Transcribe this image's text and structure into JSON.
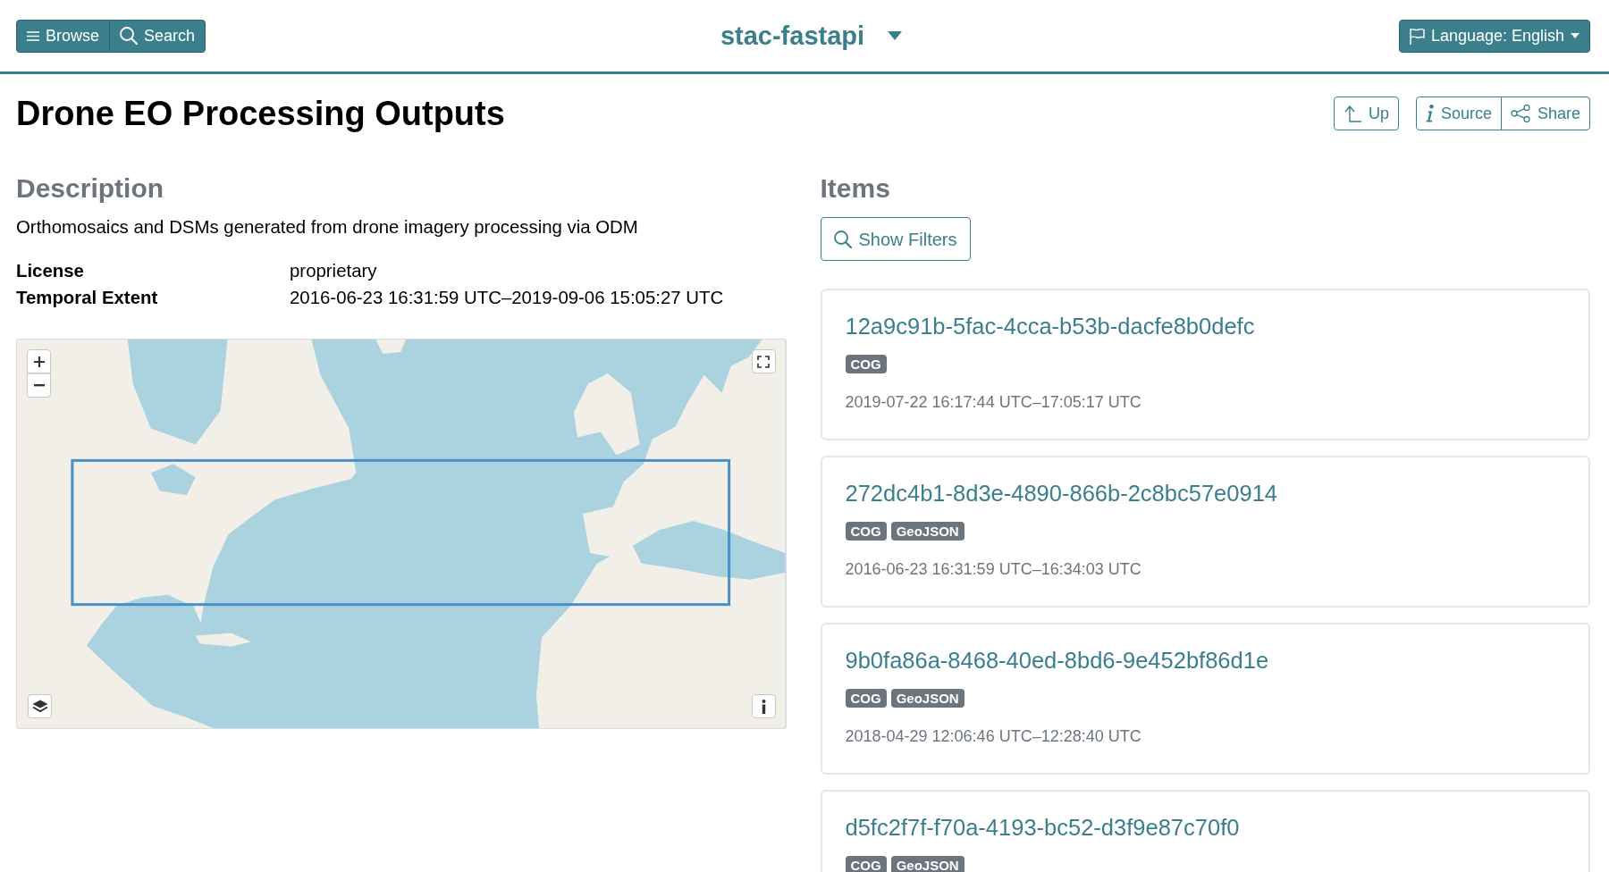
{
  "navbar": {
    "browse_button": "Browse",
    "search_button": "Search",
    "title": "stac-fastapi",
    "language_button": "Language: English"
  },
  "header": {
    "title": "Drone EO Processing Outputs",
    "up_button": "Up",
    "source_button": "Source",
    "share_button": "Share"
  },
  "description": {
    "heading": "Description",
    "text": "Orthomosaics and DSMs generated from drone imagery processing via ODM",
    "metadata": [
      {
        "label": "License",
        "value": "proprietary"
      },
      {
        "label": "Temporal Extent",
        "value": "2016-06-23 16:31:59 UTC–2019-09-06 15:05:27 UTC"
      }
    ]
  },
  "items": {
    "heading": "Items",
    "filter_button": "Show Filters",
    "list": [
      {
        "id": "12a9c91b-5fac-4cca-b53b-dacfe8b0defc",
        "tags": [
          "COG"
        ],
        "datetime": "2019-07-22 16:17:44 UTC–17:05:17 UTC"
      },
      {
        "id": "272dc4b1-8d3e-4890-866b-2c8bc57e0914",
        "tags": [
          "COG",
          "GeoJSON"
        ],
        "datetime": "2016-06-23 16:31:59 UTC–16:34:03 UTC"
      },
      {
        "id": "9b0fa86a-8468-40ed-8bd6-9e452bf86d1e",
        "tags": [
          "COG",
          "GeoJSON"
        ],
        "datetime": "2018-04-29 12:06:46 UTC–12:28:40 UTC"
      },
      {
        "id": "d5fc2f7f-f70a-4193-bc52-d3f9e87c70f0",
        "tags": [
          "COG",
          "GeoJSON"
        ]
      }
    ]
  }
}
